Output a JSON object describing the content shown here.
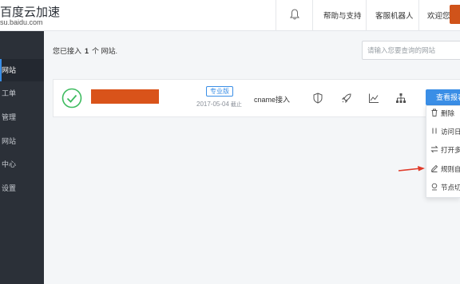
{
  "header": {
    "logo_title": "百度云加速",
    "logo_sub": "su.baidu.com",
    "help_link": "帮助与支持",
    "bot_link": "客服机器人",
    "welcome": "欢迎您,"
  },
  "sidebar": {
    "items": [
      {
        "label": "网站",
        "active": true
      },
      {
        "label": "工单",
        "active": false
      },
      {
        "label": "管理",
        "active": false
      },
      {
        "label": "网站",
        "active": false
      },
      {
        "label": "中心",
        "active": false
      },
      {
        "label": "设置",
        "active": false
      }
    ]
  },
  "main": {
    "summary_prefix": "您已接入",
    "site_count": "1",
    "summary_suffix": "个 网站.",
    "search_placeholder": "请输入您要查询的网站"
  },
  "site": {
    "plan": "专业版",
    "date": "2017-05-04",
    "date_suffix": "截止",
    "access_type": "cname接入",
    "report_button": "查看报表",
    "status_color": "#3dbb5f"
  },
  "dropdown": {
    "items": [
      {
        "label": "删除",
        "icon": "trash-icon"
      },
      {
        "label": "访问日志",
        "icon": "pause-icon"
      },
      {
        "label": "打开多语言",
        "icon": "switch-icon"
      },
      {
        "label": "规则自定义",
        "icon": "pencil-icon"
      },
      {
        "label": "节点切换",
        "icon": "node-icon"
      }
    ]
  },
  "colors": {
    "accent": "#3a8ee6",
    "sidebar_bg": "#2b3038",
    "redaction": "#d9531a",
    "arrow": "#e03b2a"
  }
}
